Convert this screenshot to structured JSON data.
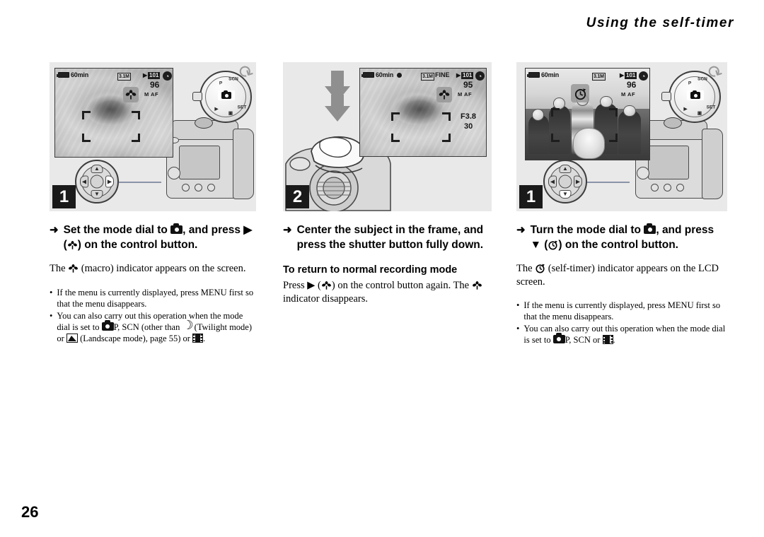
{
  "header": {
    "title": "Using the self-timer"
  },
  "page_number": "26",
  "icons": {
    "camera": "camera-mode-icon",
    "macro": "macro-flower-icon",
    "selftimer": "self-timer-clock-icon",
    "moon": "twilight-moon-icon",
    "landscape": "landscape-mountain-icon",
    "movie": "movie-film-icon",
    "arrow_right": "▶",
    "arrow_down": "▼",
    "arrow_bullet": "➜",
    "bullet_dot": "•"
  },
  "columns": [
    {
      "step": "1",
      "panel": {
        "name": "macro-setup-illustration",
        "lcd": {
          "photo": "rose-closeup",
          "battery_time": "60min",
          "resolution": "3.1M",
          "folder": "101",
          "shots_remaining": "96",
          "focus_mode": "M AF",
          "macro_indicator": true,
          "af_frame": true,
          "record_dot": false
        },
        "mode_dial": {
          "selected": "camera-still",
          "rotating_arrow": true
        },
        "control_button": {
          "highlighted": "right"
        }
      },
      "instruction": {
        "prefix": "Set the mode dial to",
        "mid": ", and press",
        "dir": "▶",
        "suffix": "on the control button."
      },
      "note": {
        "pre": "The",
        "post": "(macro) indicator appears on the screen."
      },
      "bullets": [
        {
          "text": "If the menu is currently displayed, press MENU first so that the menu disappears."
        },
        {
          "pre": "You can also carry out this operation when the mode dial is set to",
          "modes": "P, SCN (other than",
          "twilight": "(Twilight mode) or",
          "landscape": "(Landscape mode), page 55) or",
          "end": "."
        }
      ]
    },
    {
      "step": "2",
      "panel": {
        "name": "shutter-press-illustration",
        "lcd": {
          "photo": "rose-closeup",
          "battery_time": "60min",
          "resolution": "3.1M",
          "quality": "FINE",
          "folder": "101",
          "shots_remaining": "95",
          "focus_mode": "M AF",
          "aperture": "F3.8",
          "shutter_speed": "30",
          "macro_indicator": true,
          "af_frame": true,
          "record_dot": true
        },
        "hand_pressing_shutter": true,
        "down_arrow": true
      },
      "instruction": {
        "full": "Center the subject in the frame, and press the shutter button fully down."
      },
      "subhead": "To return to normal recording mode",
      "subbody": {
        "pre": "Press",
        "dir": "▶",
        "mid": "on the control button again. The",
        "post": "indicator disappears."
      }
    },
    {
      "step": "1",
      "panel": {
        "name": "self-timer-setup-illustration",
        "lcd": {
          "photo": "group-portrait-with-dog",
          "battery_time": "60min",
          "resolution": "3.1M",
          "folder": "101",
          "shots_remaining": "96",
          "focus_mode": "M AF",
          "selftimer_indicator": true,
          "af_frame": true,
          "record_dot": false
        },
        "mode_dial": {
          "selected": "camera-still",
          "rotating_arrow": true
        },
        "control_button": {
          "highlighted": "down"
        }
      },
      "instruction": {
        "prefix": "Turn the mode dial to",
        "mid": ", and press",
        "dir": "▼",
        "suffix": "on the control button."
      },
      "note": {
        "pre": "The",
        "post": "(self-timer) indicator appears on the LCD screen."
      },
      "bullets": [
        {
          "text": "If the menu is currently displayed, press MENU first so that the menu disappears."
        },
        {
          "pre": "You can also carry out this operation when the mode dial is set to",
          "modes": "P, SCN or",
          "end": "."
        }
      ]
    }
  ],
  "colors": {
    "panel_bg": "#e9e9e9",
    "badge_bg": "#1a1a1a",
    "lcd_bg": "#9c9c9c",
    "text": "#000000",
    "lead_line": "#8a93a8"
  }
}
